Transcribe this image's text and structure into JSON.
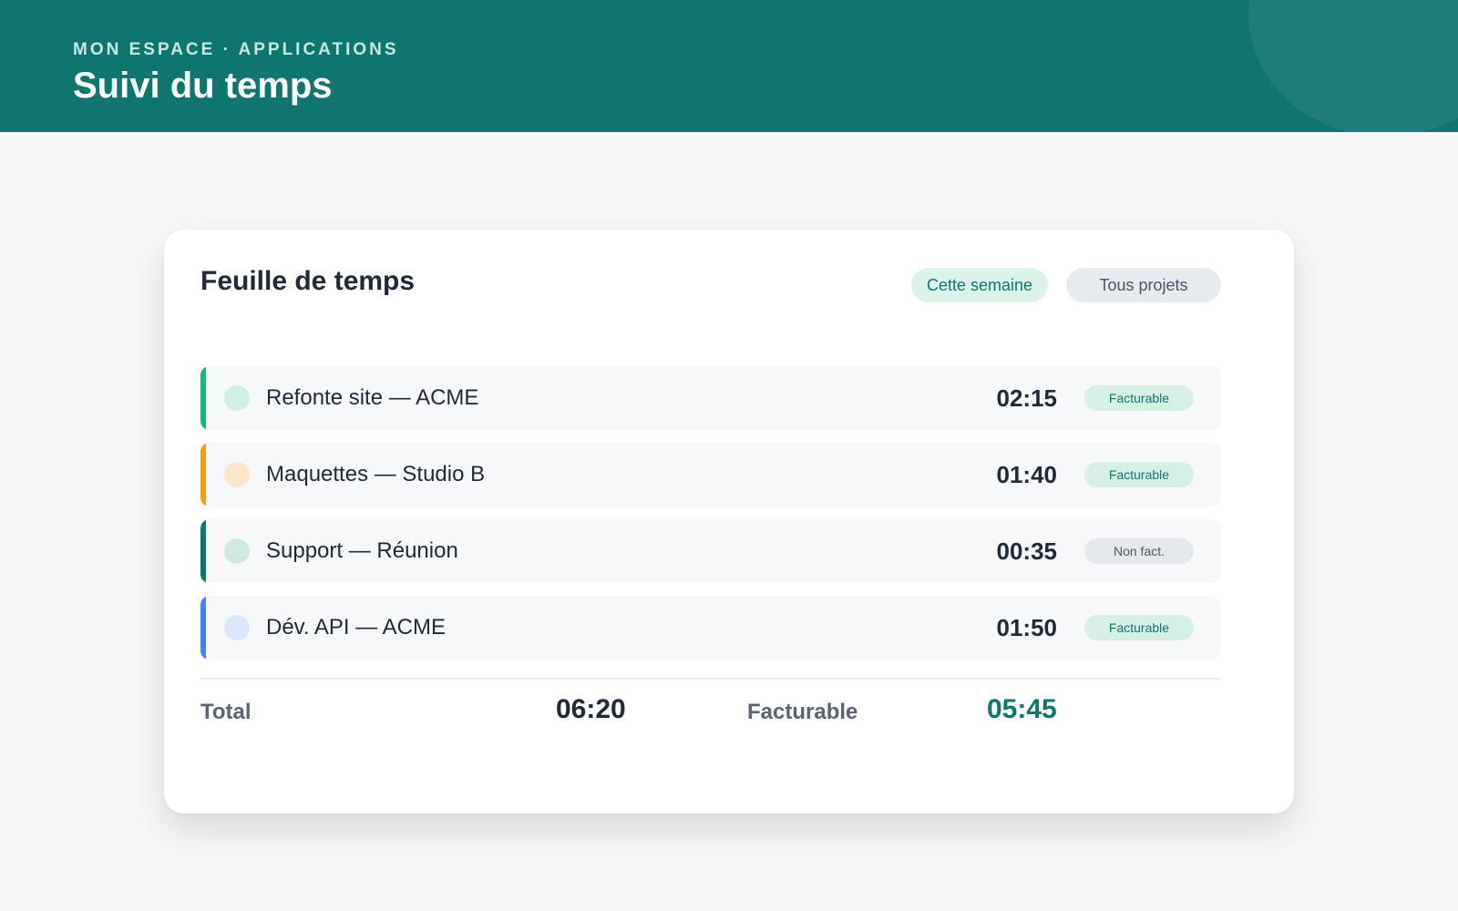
{
  "header": {
    "breadcrumb": "MON ESPACE · APPLICATIONS",
    "title": "Suivi du temps"
  },
  "card": {
    "title": "Feuille de temps",
    "filters": {
      "week": "Cette semaine",
      "projects": "Tous projets"
    },
    "rows": [
      {
        "project": "Refonte site — ACME",
        "duration": "02:15",
        "status": "Facturable",
        "accent": "#10b981",
        "dot": "#d1f0e4"
      },
      {
        "project": "Maquettes — Studio B",
        "duration": "01:40",
        "status": "Facturable",
        "accent": "#f59e0b",
        "dot": "#fbe8cc"
      },
      {
        "project": "Support — Réunion",
        "duration": "00:35",
        "status": "Non fact.",
        "accent": "#0f766e",
        "dot": "#cfe9e2"
      },
      {
        "project": "Dév. API — ACME",
        "duration": "01:50",
        "status": "Facturable",
        "accent": "#3b82f6",
        "dot": "#dbe7fb"
      }
    ],
    "summary": {
      "total_label": "Total",
      "total_value": "06:20",
      "billable_label": "Facturable",
      "billable_value": "05:45"
    }
  },
  "colors": {
    "brand": "#0f766e",
    "background": "#f6f7f8"
  }
}
